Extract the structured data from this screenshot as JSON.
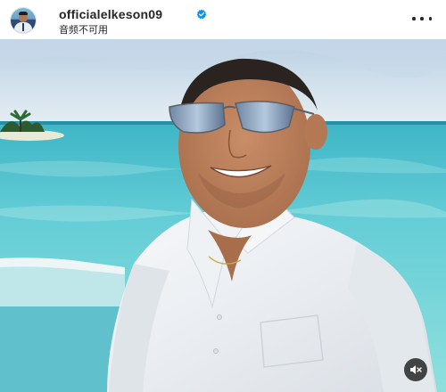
{
  "post": {
    "username": "officialelkeson09",
    "audio_status": "音频不可用",
    "icons": {
      "avatar": "profile-avatar",
      "verified": "verified-badge-icon",
      "more": "more-options-icon",
      "mute": "audio-muted-icon"
    },
    "colors": {
      "verified_blue": "#0095f6",
      "text": "#262626"
    }
  }
}
